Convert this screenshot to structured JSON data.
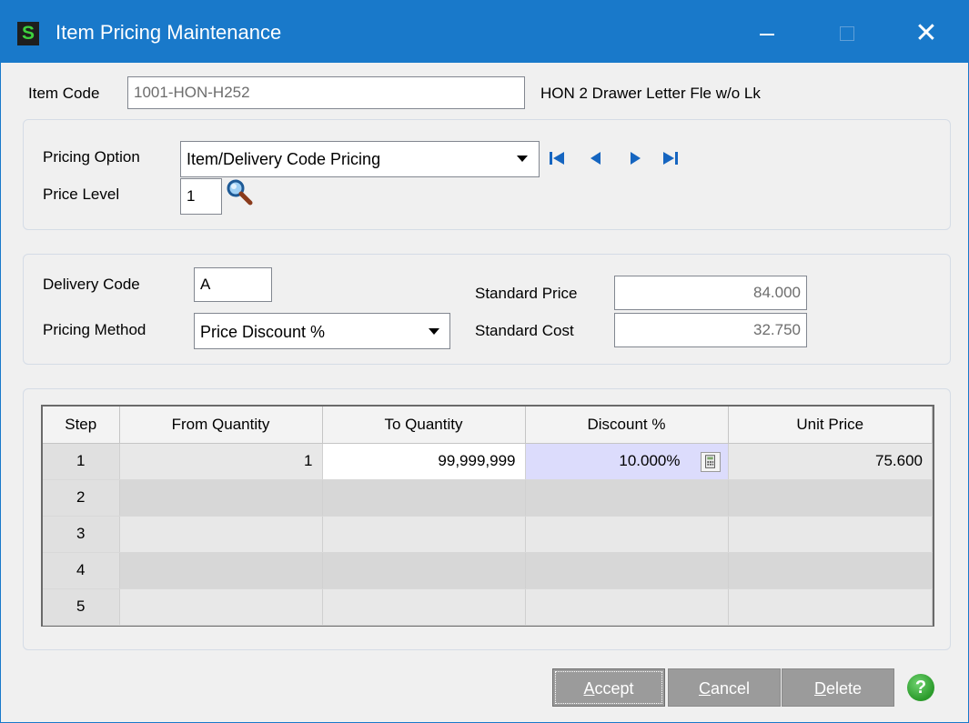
{
  "window": {
    "title": "Item Pricing Maintenance",
    "app_icon_letter": "S"
  },
  "titlebar": {
    "minimize": "—",
    "close": "✕"
  },
  "item": {
    "code_label": "Item Code",
    "code_value": "1001-HON-H252",
    "description": "HON 2 Drawer Letter Fle w/o Lk"
  },
  "pricing": {
    "option_label": "Pricing Option",
    "option_value": "Item/Delivery Code Pricing",
    "level_label": "Price Level",
    "level_value": "1"
  },
  "delivery": {
    "code_label": "Delivery Code",
    "code_value": "A",
    "method_label": "Pricing Method",
    "method_value": "Price Discount %",
    "std_price_label": "Standard Price",
    "std_price_value": "84.000",
    "std_cost_label": "Standard Cost",
    "std_cost_value": "32.750"
  },
  "grid": {
    "headers": [
      "Step",
      "From Quantity",
      "To Quantity",
      "Discount %",
      "Unit Price"
    ],
    "rows": [
      {
        "step": "1",
        "from": "1",
        "to": "99,999,999",
        "discount": "10.000%",
        "unit_price": "75.600"
      },
      {
        "step": "2",
        "from": "",
        "to": "",
        "discount": "",
        "unit_price": ""
      },
      {
        "step": "3",
        "from": "",
        "to": "",
        "discount": "",
        "unit_price": ""
      },
      {
        "step": "4",
        "from": "",
        "to": "",
        "discount": "",
        "unit_price": ""
      },
      {
        "step": "5",
        "from": "",
        "to": "",
        "discount": "",
        "unit_price": ""
      }
    ]
  },
  "buttons": {
    "accept_first": "A",
    "accept_rest": "ccept",
    "cancel_first": "C",
    "cancel_rest": "ancel",
    "delete_first": "D",
    "delete_rest": "elete",
    "help": "?"
  },
  "colors": {
    "titlebar": "#1979ca",
    "nav_blue": "#1565c0",
    "active_cell": "#dcdcfc",
    "button_gray": "#9b9b9b",
    "help_green": "#2a9a2a"
  },
  "icons": {
    "search": "magnifier-icon",
    "nav_first": "first-record-icon",
    "nav_prev": "previous-record-icon",
    "nav_next": "next-record-icon",
    "nav_last": "last-record-icon",
    "calculator": "calculator-icon"
  }
}
